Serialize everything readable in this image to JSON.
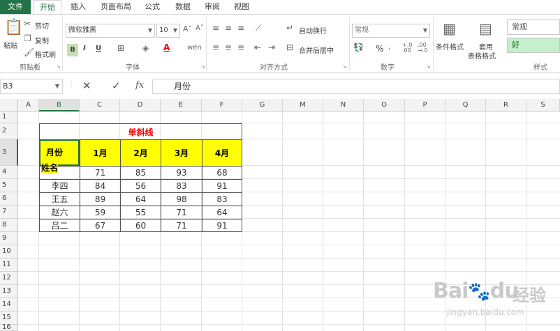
{
  "tabs": [
    "文件",
    "开始",
    "插入",
    "页面布局",
    "公式",
    "数据",
    "审阅",
    "视图"
  ],
  "clipboard": {
    "paste": "粘贴",
    "cut": "剪切",
    "copy": "复制",
    "format_painter": "格式刷",
    "label": "剪贴板"
  },
  "font": {
    "font_name": "微软雅黑",
    "font_size": "10",
    "label": "字体",
    "bold": "B",
    "italic": "I",
    "underline": "U"
  },
  "alignment": {
    "wrap_text": "自动换行",
    "merge_center": "合并后居中",
    "label": "对齐方式"
  },
  "number": {
    "format": "常规",
    "label": "数字",
    "percent": "%"
  },
  "styles": {
    "conditional": "条件格式",
    "table_format": "套用",
    "table_format2": "表格格式",
    "normal": "常规",
    "good": "好",
    "label": "样式"
  },
  "formula_bar": {
    "name_box": "B3",
    "content": "月份"
  },
  "columns": [
    "A",
    "B",
    "C",
    "D",
    "E",
    "F",
    "G",
    "M",
    "N",
    "O",
    "P",
    "Q",
    "R",
    "S"
  ],
  "rows": [
    "1",
    "2",
    "3",
    "4",
    "5",
    "6",
    "7",
    "8",
    "9",
    "10",
    "11",
    "12",
    "13",
    "14",
    "15",
    "16"
  ],
  "sheet": {
    "title": "单斜线",
    "header_top": "月份",
    "header_bottom": "姓名",
    "months": [
      "1月",
      "2月",
      "3月",
      "4月"
    ],
    "data": [
      {
        "name": "",
        "values": [
          "71",
          "85",
          "93",
          "68"
        ]
      },
      {
        "name": "李四",
        "values": [
          "84",
          "56",
          "83",
          "91"
        ]
      },
      {
        "name": "王五",
        "values": [
          "89",
          "64",
          "98",
          "83"
        ]
      },
      {
        "name": "赵六",
        "values": [
          "59",
          "55",
          "71",
          "64"
        ]
      },
      {
        "name": "吕二",
        "values": [
          "67",
          "60",
          "71",
          "91"
        ]
      }
    ]
  },
  "watermark": {
    "brand": "Bai",
    "brand2": "du",
    "cn": "经验",
    "url": "jingyan.baidu.com"
  }
}
